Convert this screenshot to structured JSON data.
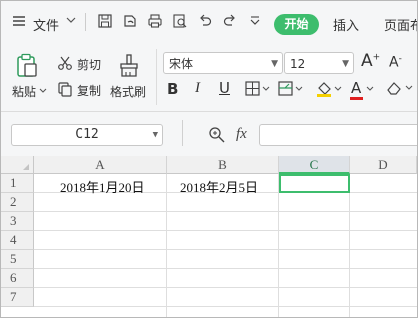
{
  "menu": {
    "hamburger_icon": "menu-icon",
    "file_label": "文件",
    "start_tab": "开始",
    "insert_tab": "插入",
    "page_tab": "页面布"
  },
  "ribbon": {
    "paste_label": "粘贴",
    "cut_label": "剪切",
    "copy_label": "复制",
    "format_painter_label": "格式刷",
    "font_name": "宋体",
    "font_size": "12",
    "bold": "B",
    "italic": "I",
    "underline": "U",
    "grow_font": "A",
    "shrink_font": "A",
    "font_color_letter": "A"
  },
  "formula_bar": {
    "name_box": "C12",
    "fx_label": "fx",
    "formula": ""
  },
  "sheet": {
    "columns": [
      "A",
      "B",
      "C",
      "D"
    ],
    "rows": [
      "1",
      "2",
      "3",
      "4",
      "5",
      "6",
      "7"
    ],
    "cells": {
      "A1": "2018年1月20日",
      "B1": "2018年2月5日"
    },
    "selected_column": "C"
  },
  "colors": {
    "accent_green": "#3dbd6d",
    "font_color_red": "#e02020",
    "highlight_yellow": "#f5d000"
  }
}
